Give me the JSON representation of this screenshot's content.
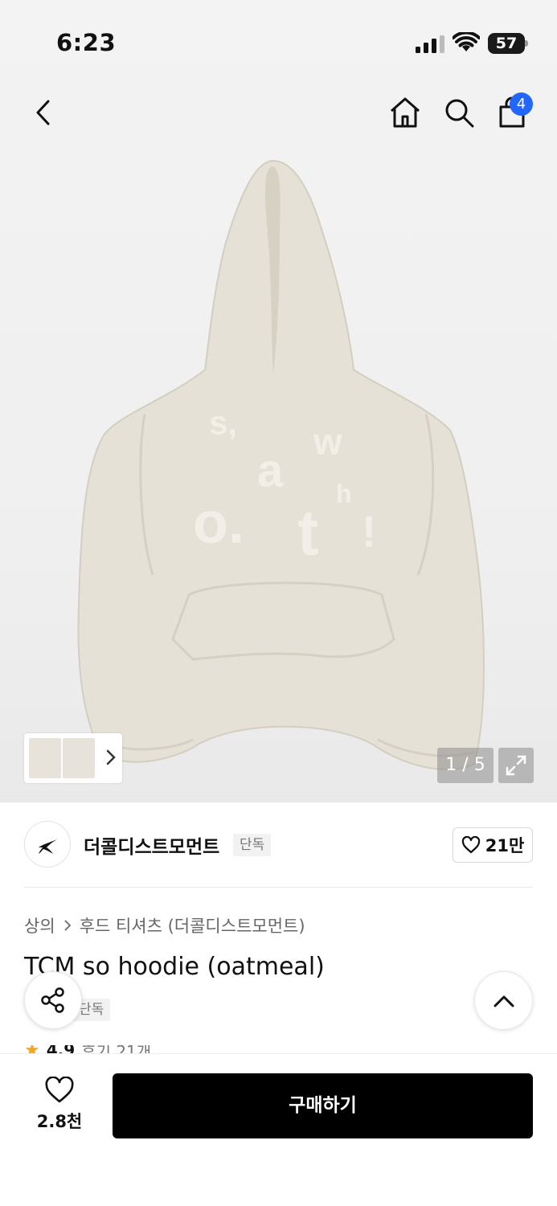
{
  "status_bar": {
    "time": "6:23",
    "battery": "57",
    "signal_icon": "cellular-signal-icon",
    "wifi_icon": "wifi-icon"
  },
  "header": {
    "back_icon": "chevron-left-icon",
    "home_icon": "home-icon",
    "search_icon": "search-icon",
    "cart_icon": "shopping-bag-icon",
    "cart_badge": "4"
  },
  "gallery": {
    "page_counter": "1 / 5",
    "current_page": 1,
    "total_pages": 5,
    "print_text": [
      "s,",
      "a",
      "w",
      "h",
      "o.",
      "t",
      "!"
    ]
  },
  "brand": {
    "name": "더콜디스트모먼트",
    "tag": "단독",
    "likes": "21만"
  },
  "product": {
    "breadcrumb": [
      "상의",
      "후드 티셔츠 (더콜디스트모먼트)"
    ],
    "title": "TCM so hoodie (oatmeal)",
    "exclusive_tag": "단독",
    "rating": "4.9",
    "reviews": "후기 21개"
  },
  "bottom_bar": {
    "wish_count": "2.8천",
    "buy_label": "구매하기"
  },
  "colors": {
    "accent_blue": "#2166ff",
    "buy_button": "#000000",
    "star": "#f5a623"
  }
}
